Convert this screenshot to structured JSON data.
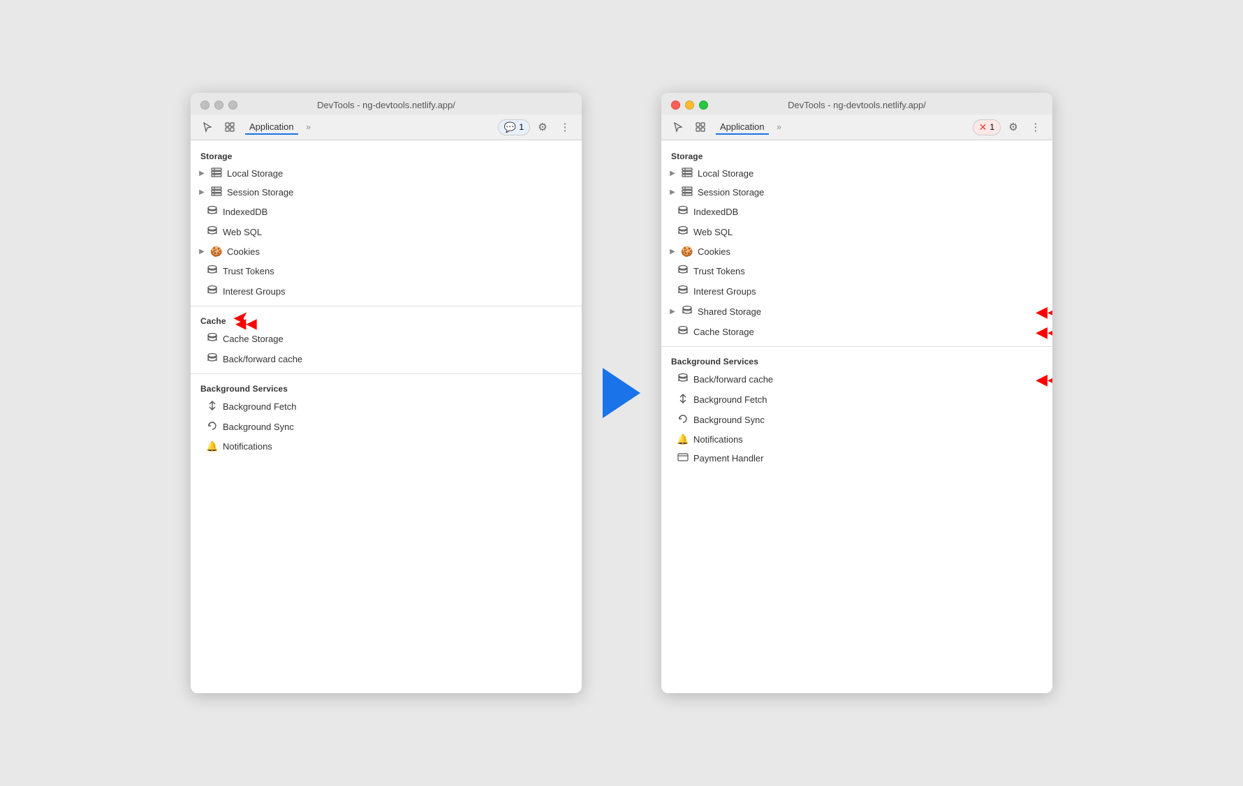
{
  "left_window": {
    "title": "DevTools - ng-devtools.netlify.app/",
    "tab_label": "Application",
    "badge": "1",
    "badge_type": "normal",
    "storage_header": "Storage",
    "cache_header": "Cache",
    "background_header": "Background Services",
    "items": {
      "storage": [
        {
          "id": "local-storage",
          "label": "Local Storage",
          "expandable": true,
          "icon": "grid"
        },
        {
          "id": "session-storage",
          "label": "Session Storage",
          "expandable": true,
          "icon": "grid"
        },
        {
          "id": "indexeddb",
          "label": "IndexedDB",
          "expandable": false,
          "icon": "db"
        },
        {
          "id": "web-sql",
          "label": "Web SQL",
          "expandable": false,
          "icon": "db"
        },
        {
          "id": "cookies",
          "label": "Cookies",
          "expandable": true,
          "icon": "cookie"
        },
        {
          "id": "trust-tokens",
          "label": "Trust Tokens",
          "expandable": false,
          "icon": "db"
        },
        {
          "id": "interest-groups",
          "label": "Interest Groups",
          "expandable": false,
          "icon": "db"
        }
      ],
      "cache": [
        {
          "id": "cache-storage",
          "label": "Cache Storage",
          "expandable": false,
          "icon": "db"
        },
        {
          "id": "backforward-cache",
          "label": "Back/forward cache",
          "expandable": false,
          "icon": "db"
        }
      ],
      "background": [
        {
          "id": "background-fetch",
          "label": "Background Fetch",
          "expandable": false,
          "icon": "arrows"
        },
        {
          "id": "background-sync",
          "label": "Background Sync",
          "expandable": false,
          "icon": "sync"
        },
        {
          "id": "notifications",
          "label": "Notifications",
          "expandable": false,
          "icon": "bell"
        }
      ]
    }
  },
  "right_window": {
    "title": "DevTools - ng-devtools.netlify.app/",
    "tab_label": "Application",
    "badge": "1",
    "badge_type": "error",
    "storage_header": "Storage",
    "background_header": "Background Services",
    "items": {
      "storage": [
        {
          "id": "local-storage",
          "label": "Local Storage",
          "expandable": true,
          "icon": "grid"
        },
        {
          "id": "session-storage",
          "label": "Session Storage",
          "expandable": true,
          "icon": "grid"
        },
        {
          "id": "indexeddb",
          "label": "IndexedDB",
          "expandable": false,
          "icon": "db"
        },
        {
          "id": "web-sql",
          "label": "Web SQL",
          "expandable": false,
          "icon": "db"
        },
        {
          "id": "cookies",
          "label": "Cookies",
          "expandable": true,
          "icon": "cookie"
        },
        {
          "id": "trust-tokens",
          "label": "Trust Tokens",
          "expandable": false,
          "icon": "db"
        },
        {
          "id": "interest-groups",
          "label": "Interest Groups",
          "expandable": false,
          "icon": "db"
        },
        {
          "id": "shared-storage",
          "label": "Shared Storage",
          "expandable": true,
          "icon": "db"
        },
        {
          "id": "cache-storage",
          "label": "Cache Storage",
          "expandable": false,
          "icon": "db"
        }
      ],
      "background": [
        {
          "id": "backforward-cache",
          "label": "Back/forward cache",
          "expandable": false,
          "icon": "db"
        },
        {
          "id": "background-fetch",
          "label": "Background Fetch",
          "expandable": false,
          "icon": "arrows"
        },
        {
          "id": "background-sync",
          "label": "Background Sync",
          "expandable": false,
          "icon": "sync"
        },
        {
          "id": "notifications",
          "label": "Notifications",
          "expandable": false,
          "icon": "bell"
        },
        {
          "id": "payment-handler",
          "label": "Payment Handler",
          "expandable": false,
          "icon": "card"
        }
      ]
    }
  },
  "icons": {
    "cursor": "⬡",
    "layers": "⧉",
    "chevron": "»",
    "gear": "⚙",
    "more": "⋮",
    "grid": "⊞",
    "db": "🗄",
    "cookie": "🍪",
    "arrows": "↕",
    "sync": "↺",
    "bell": "🔔",
    "card": "💳",
    "expand": "▶"
  }
}
